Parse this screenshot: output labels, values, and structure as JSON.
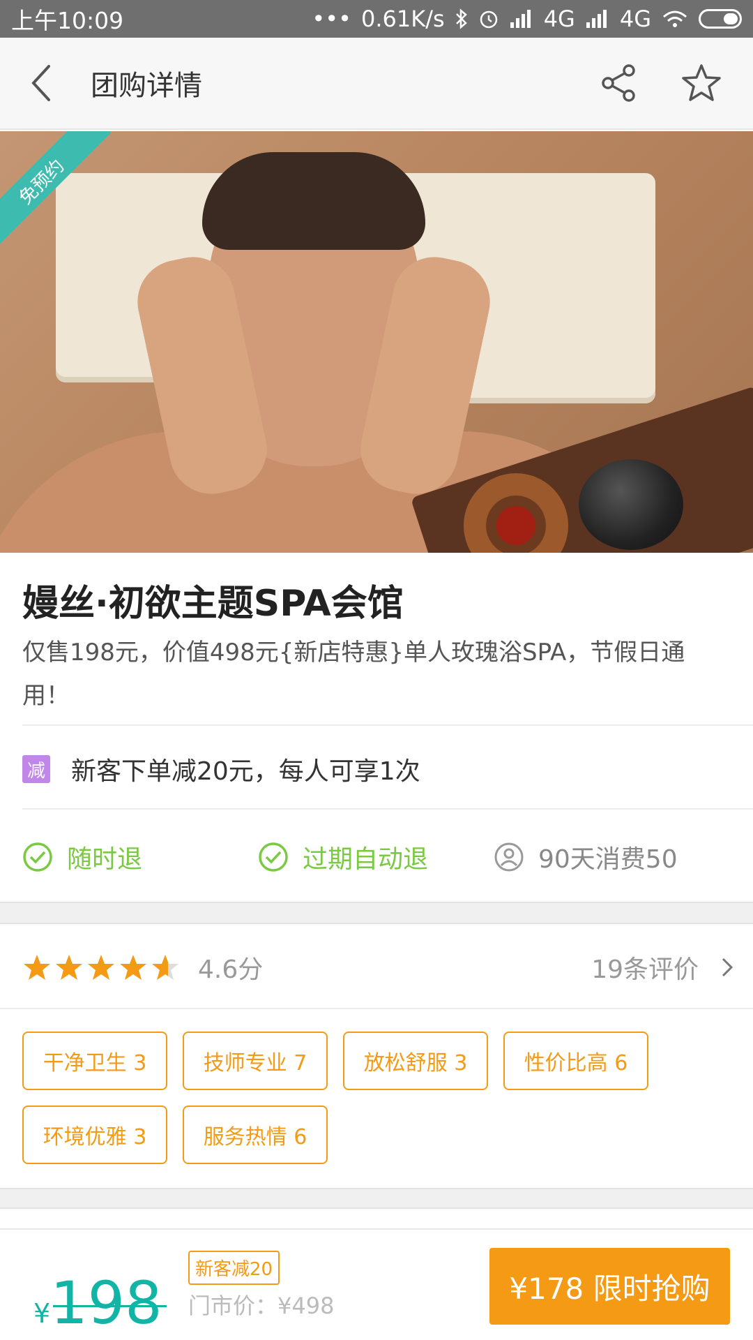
{
  "status_bar": {
    "time": "上午10:09",
    "dots": "•••",
    "speed": "0.61K/s",
    "network1": "4G",
    "network2": "4G"
  },
  "header": {
    "title": "团购详情"
  },
  "hero": {
    "ribbon": "免预约"
  },
  "deal": {
    "shop_name": "嫚丝·初欲主题SPA会馆",
    "description": "仅售198元，价值498元{新店特惠}单人玫瑰浴SPA，节假日通用！",
    "promo_badge": "减",
    "promo_text": "新客下单减20元，每人可享1次",
    "guarantees": [
      {
        "label": "随时退"
      },
      {
        "label": "过期自动退"
      },
      {
        "label": "90天消费50"
      }
    ]
  },
  "rating": {
    "stars": 4.6,
    "score_text": "4.6分",
    "reviews_text": "19条评价"
  },
  "tags": [
    {
      "label": "干净卫生  3"
    },
    {
      "label": "技师专业  7"
    },
    {
      "label": "放松舒服  3"
    },
    {
      "label": "性价比高  6"
    },
    {
      "label": "环境优雅  3"
    },
    {
      "label": "服务热情  6"
    }
  ],
  "bottom_bar": {
    "currency": "¥",
    "price": "198",
    "new_customer_badge": "新客减20",
    "market_price": "门市价：¥498",
    "buy_button": "¥178 限时抢购"
  },
  "colors": {
    "accent_orange": "#f49a14",
    "accent_teal": "#12b5a5",
    "check_green": "#7ac943",
    "promo_purple": "#c086e8"
  }
}
